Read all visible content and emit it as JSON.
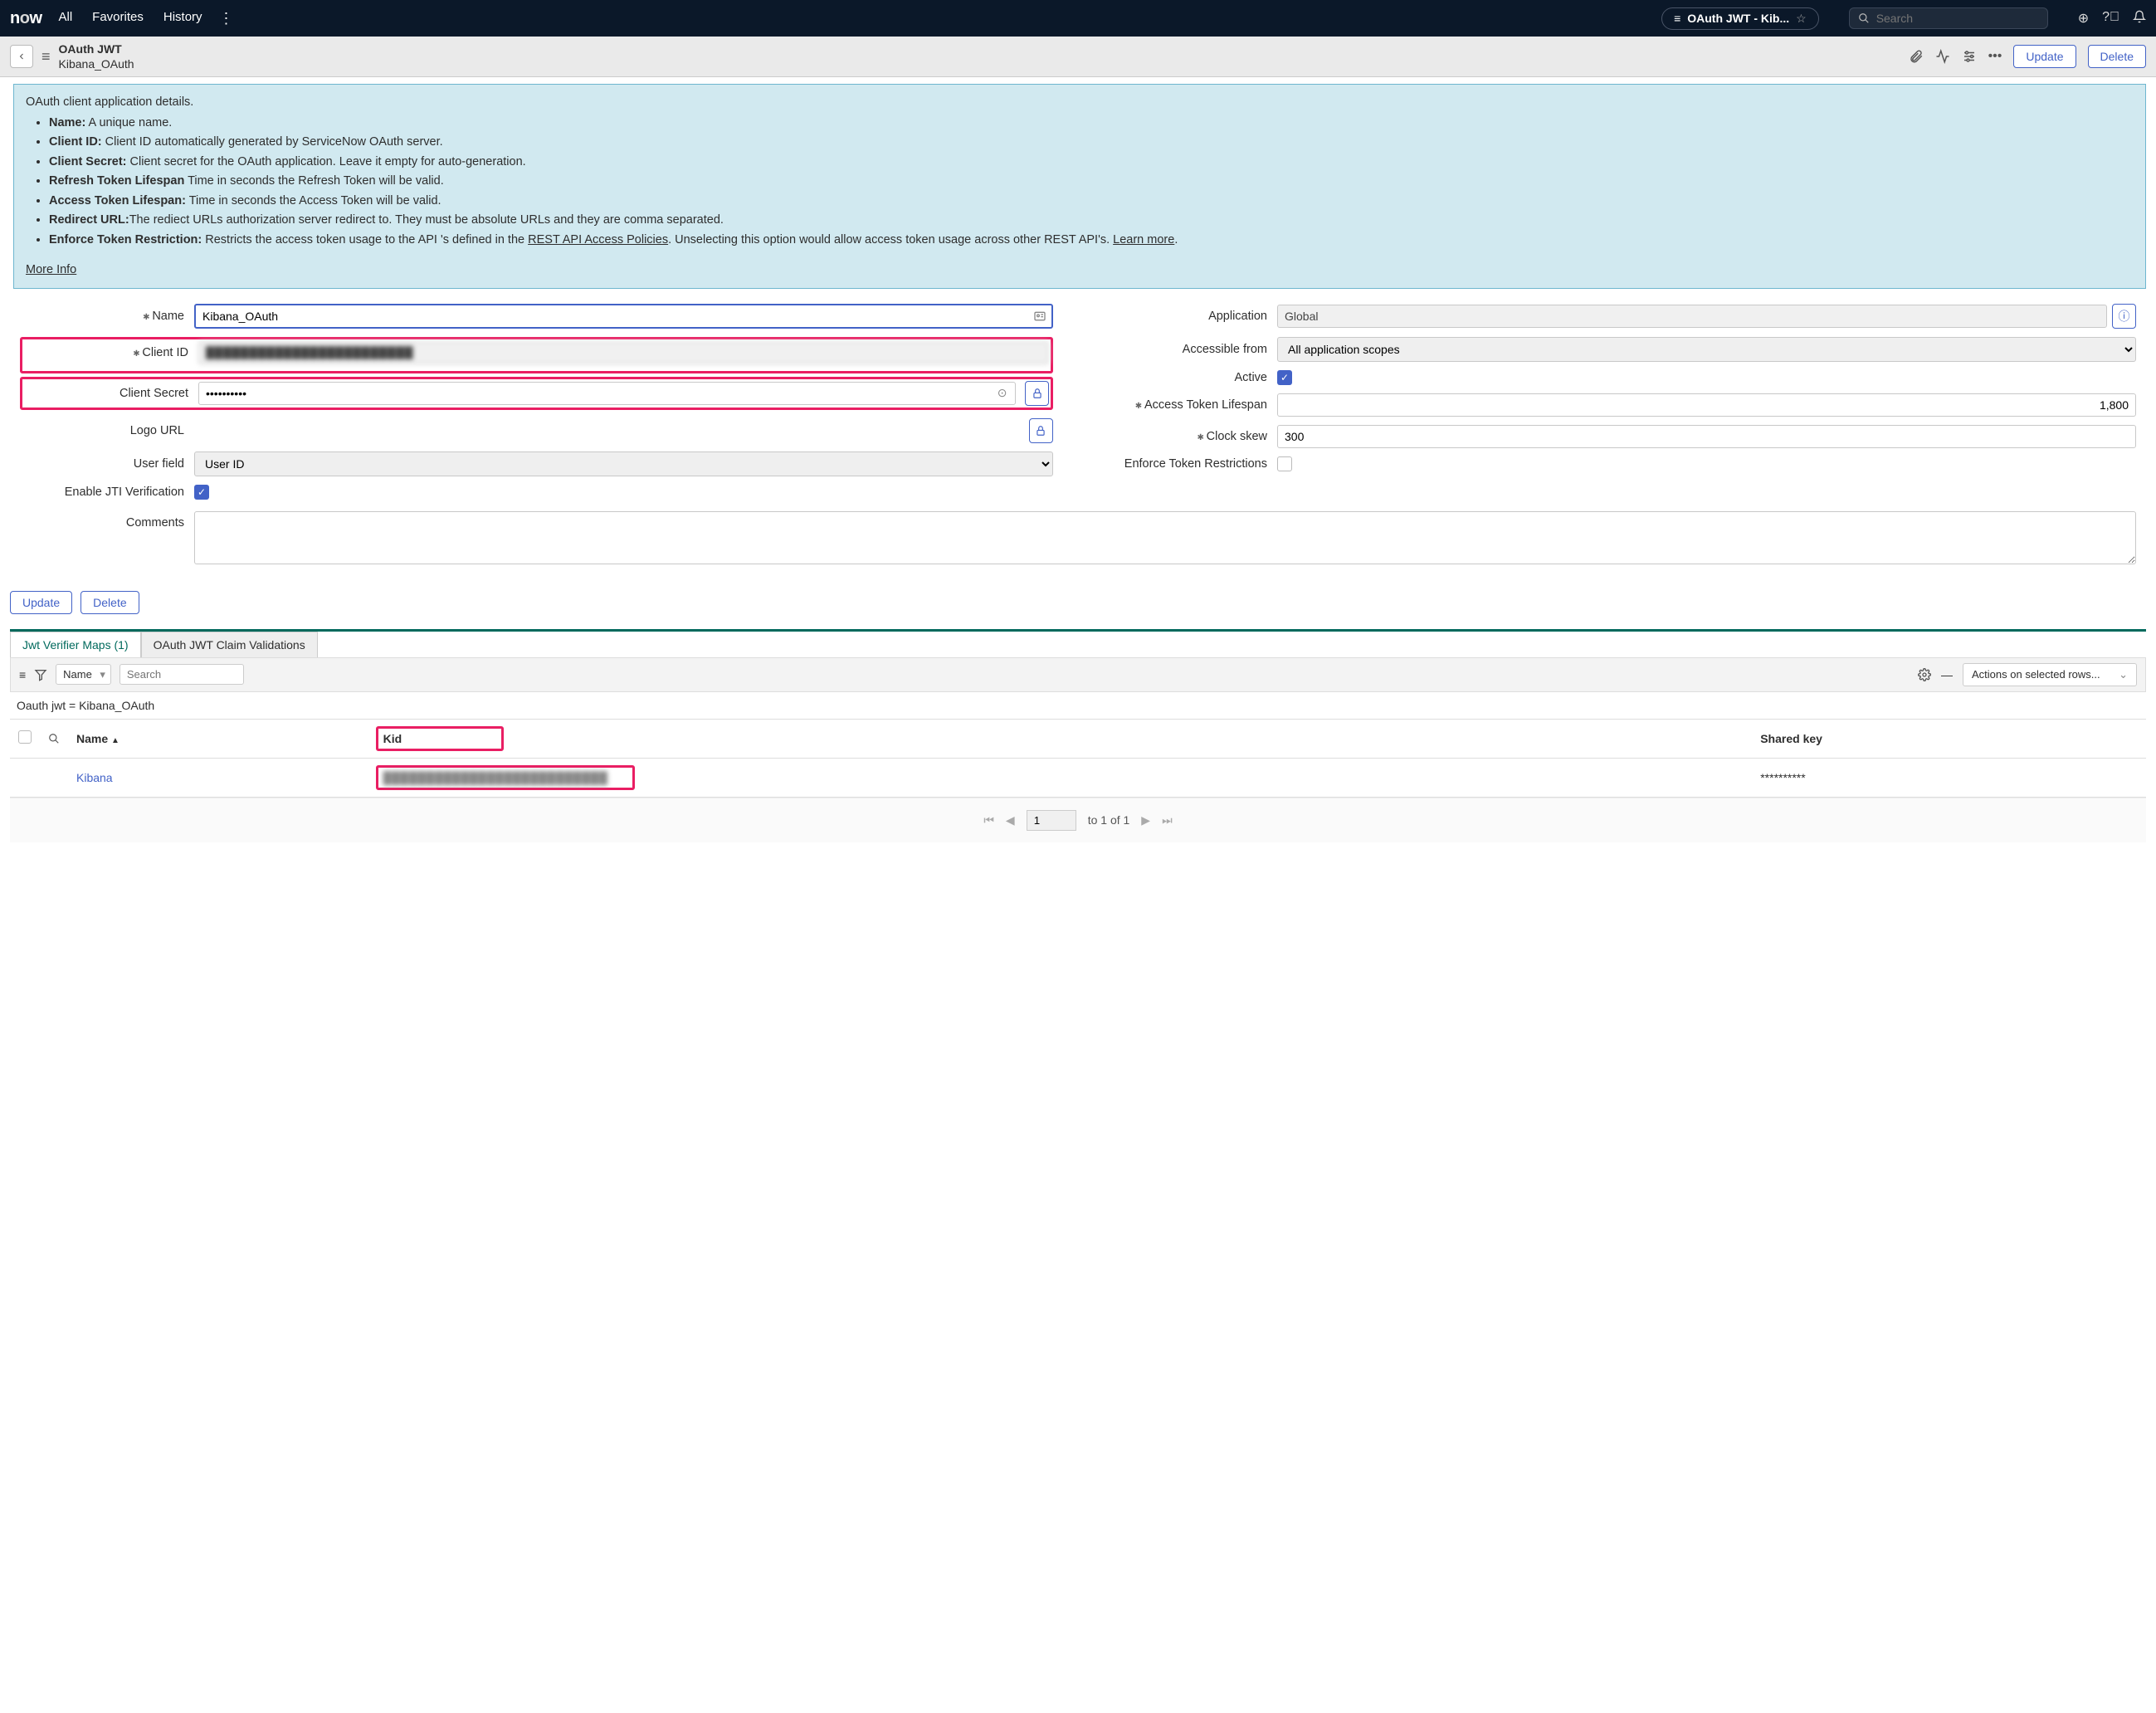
{
  "topnav": {
    "links": [
      "All",
      "Favorites",
      "History"
    ],
    "tab_label": "OAuth JWT - Kib...",
    "search_placeholder": "Search"
  },
  "subhdr": {
    "title1": "OAuth JWT",
    "title2": "Kibana_OAuth",
    "update_label": "Update",
    "delete_label": "Delete"
  },
  "info": {
    "heading": "OAuth client application details.",
    "items": [
      {
        "label": "Name:",
        "text": " A unique name."
      },
      {
        "label": "Client ID:",
        "text": " Client ID automatically generated by ServiceNow OAuth server."
      },
      {
        "label": "Client Secret:",
        "text": " Client secret for the OAuth application. Leave it empty for auto-generation."
      },
      {
        "label": "Refresh Token Lifespan",
        "text": " Time in seconds the Refresh Token will be valid."
      },
      {
        "label": "Access Token Lifespan:",
        "text": " Time in seconds the Access Token will be valid."
      },
      {
        "label": "Redirect URL:",
        "text": "The rediect URLs authorization server redirect to. They must be absolute URLs and they are comma separated."
      },
      {
        "label": "Enforce Token Restriction:",
        "text_a": " Restricts the access token usage to the API 's defined in the ",
        "link": "REST API Access Policies",
        "text_b": ". Unselecting this option would allow access token usage across other REST API's. ",
        "link2": "Learn more",
        "tail": "."
      }
    ],
    "more": "More Info"
  },
  "form": {
    "name_label": "Name",
    "name_value": "Kibana_OAuth",
    "client_id_label": "Client ID",
    "client_id_value": "████████████████████████",
    "client_secret_label": "Client Secret",
    "client_secret_value": "••••••••••",
    "logo_url_label": "Logo URL",
    "user_field_label": "User field",
    "user_field_value": "User ID",
    "jti_label": "Enable JTI Verification",
    "comments_label": "Comments",
    "application_label": "Application",
    "application_value": "Global",
    "accessible_label": "Accessible from",
    "accessible_value": "All application scopes",
    "active_label": "Active",
    "token_lifespan_label": "Access Token Lifespan",
    "token_lifespan_value": "1,800",
    "clock_skew_label": "Clock skew",
    "clock_skew_value": "300",
    "enforce_label": "Enforce Token Restrictions"
  },
  "bottom": {
    "update_label": "Update",
    "delete_label": "Delete"
  },
  "tabs": {
    "tab1": "Jwt Verifier Maps (1)",
    "tab2": "OAuth JWT Claim Validations"
  },
  "list": {
    "search_field_sel": "Name",
    "search_placeholder": "Search",
    "actions_label": "Actions on selected rows...",
    "filter_text": "Oauth jwt = Kibana_OAuth",
    "col_name": "Name",
    "col_kid": "Kid",
    "col_shared": "Shared key",
    "row_name": "Kibana",
    "row_kid": "██████████████████████████",
    "row_shared": "**********",
    "pager_current": "1",
    "pager_text": "to 1 of 1"
  }
}
